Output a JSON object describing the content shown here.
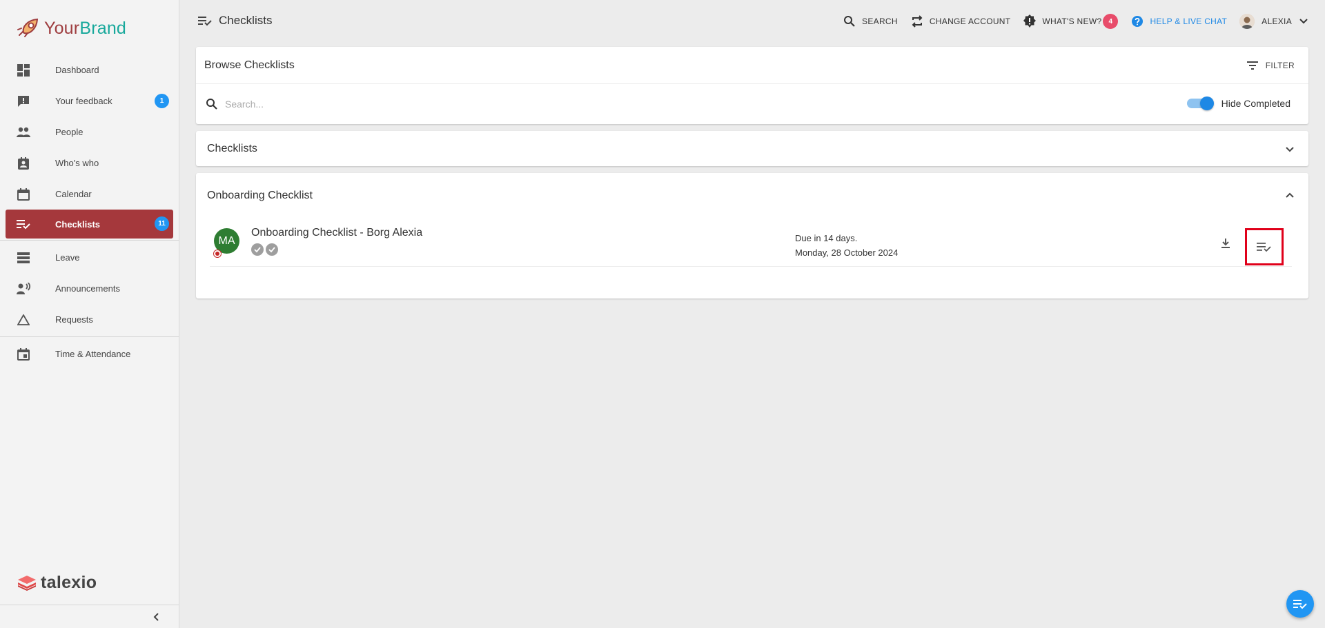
{
  "brand": {
    "part1": "Your",
    "part2": "Brand"
  },
  "sidebar": {
    "items": [
      {
        "label": "Dashboard",
        "icon": "dashboard-icon"
      },
      {
        "label": "Your feedback",
        "icon": "feedback-icon",
        "badge": "1"
      },
      {
        "label": "People",
        "icon": "people-icon"
      },
      {
        "label": "Who's who",
        "icon": "contact-card-icon"
      },
      {
        "label": "Calendar",
        "icon": "calendar-icon"
      },
      {
        "label": "Checklists",
        "icon": "checklist-icon",
        "badge": "11",
        "active": true
      },
      {
        "label": "Leave",
        "icon": "leave-icon"
      },
      {
        "label": "Announcements",
        "icon": "announcements-icon"
      },
      {
        "label": "Requests",
        "icon": "requests-icon"
      },
      {
        "label": "Time & Attendance",
        "icon": "time-attendance-icon"
      }
    ],
    "footer_logo": "talexio"
  },
  "header": {
    "title": "Checklists",
    "search_label": "SEARCH",
    "change_account_label": "CHANGE ACCOUNT",
    "whats_new_label": "WHAT'S NEW?",
    "whats_new_count": "4",
    "help_label": "HELP & LIVE CHAT",
    "user_name": "ALEXIA"
  },
  "browse": {
    "title": "Browse Checklists",
    "filter_label": "FILTER",
    "search_placeholder": "Search...",
    "hide_completed_label": "Hide Completed",
    "hide_completed_on": true
  },
  "sections": {
    "checklists_title": "Checklists",
    "onboarding_title": "Onboarding Checklist"
  },
  "checklist_row": {
    "avatar_initials": "MA",
    "title": "Onboarding Checklist - Borg Alexia",
    "due_line1": "Due in 14 days.",
    "due_line2": "Monday, 28 October 2024"
  },
  "colors": {
    "active_nav": "#a5383c",
    "accent_blue": "#2196f3",
    "brand_red": "#9e3d3f",
    "brand_teal": "#17a89b",
    "highlight_border": "#e0001a"
  }
}
